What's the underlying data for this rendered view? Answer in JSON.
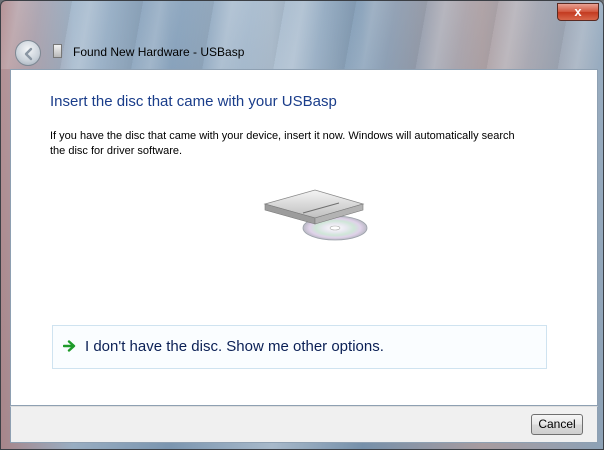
{
  "window": {
    "title": "Found New Hardware - USBasp",
    "close_label": "x"
  },
  "main": {
    "heading": "Insert the disc that came with your USBasp",
    "description": "If you have the disc that came with your device, insert it now.  Windows will automatically search the disc for driver software.",
    "option_label": "I don't have the disc.  Show me other options."
  },
  "footer": {
    "cancel_label": "Cancel"
  },
  "icons": {
    "back": "back-arrow-icon",
    "hardware": "hardware-device-icon",
    "disc_drive": "disc-drive-icon",
    "option_arrow": "green-arrow-icon"
  },
  "colors": {
    "heading": "#1a3d8a",
    "option_text": "#0a1f55",
    "arrow_green": "#1e9b2a",
    "close_red": "#c33a20"
  }
}
